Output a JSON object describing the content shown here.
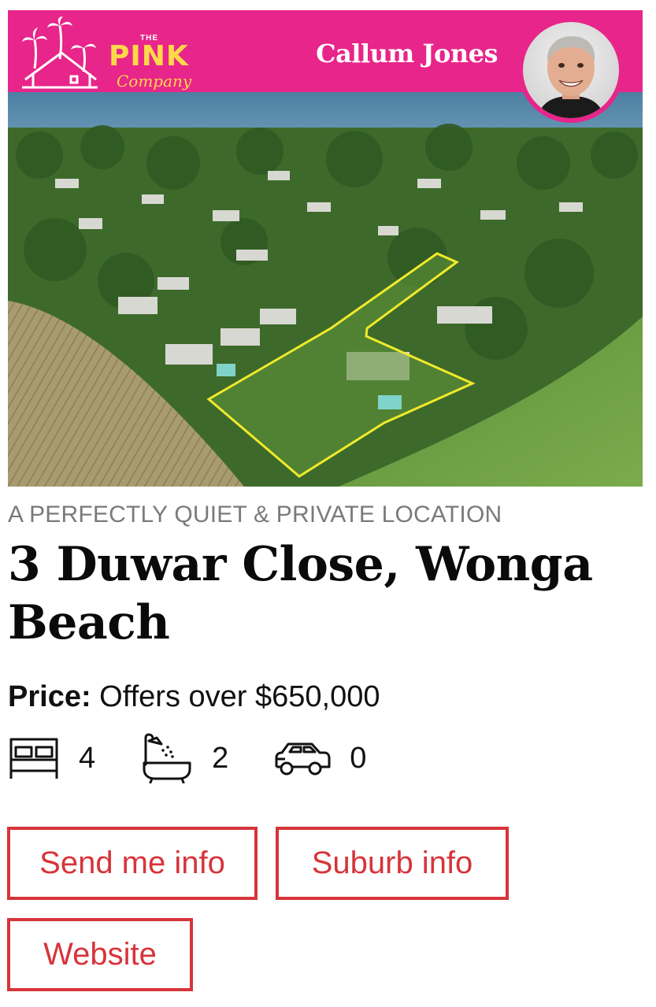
{
  "brand": {
    "logo_small": "THE",
    "logo_main": "PINK",
    "logo_sub": "Company",
    "accent_color": "#e8258a"
  },
  "agent": {
    "name": "Callum Jones"
  },
  "listing": {
    "tagline": "A PERFECTLY QUIET & PRIVATE LOCATION",
    "title": "3 Duwar Close, Wonga Beach",
    "price_label": "Price:",
    "price_value": " Offers over $650,000",
    "features": {
      "beds": "4",
      "baths": "2",
      "cars": "0"
    }
  },
  "actions": {
    "send_info": "Send me info",
    "suburb_info": "Suburb info",
    "website": "Website",
    "button_color": "#d7343a"
  },
  "icons": [
    "bed-icon",
    "bath-icon",
    "car-icon",
    "palm-house-logo-icon"
  ]
}
